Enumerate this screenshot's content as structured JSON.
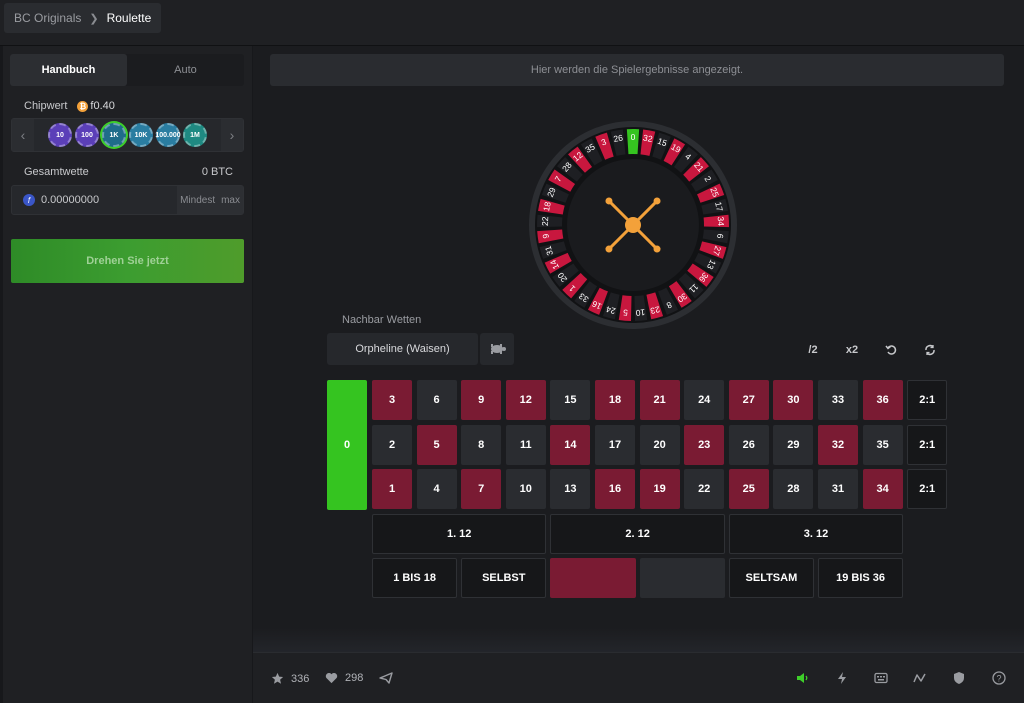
{
  "breadcrumb": {
    "parent": "BC Originals",
    "current": "Roulette"
  },
  "left_panel": {
    "tabs": [
      {
        "label": "Handbuch",
        "active": true
      },
      {
        "label": "Auto",
        "active": false
      }
    ],
    "chip_value_label": "Chipwert",
    "chip_value": "0.40",
    "chip_value_prefix": "f",
    "chips": [
      {
        "label": "10",
        "color": "#5b3fb8",
        "selected": false
      },
      {
        "label": "100",
        "color": "#5b3fb8",
        "selected": false
      },
      {
        "label": "1K",
        "color": "#1f6c8a",
        "selected": true
      },
      {
        "label": "10K",
        "color": "#2a7da1",
        "selected": false
      },
      {
        "label": "100.000",
        "color": "#2a7da1",
        "selected": false
      },
      {
        "label": "1M",
        "color": "#1f8a82",
        "selected": false
      }
    ],
    "total_bet_label": "Gesamtwette",
    "total_bet_value": "0 BTC",
    "bet_input_value": "0.00000000",
    "bet_min_label": "Mindest",
    "bet_max_label": "max",
    "spin_label": "Drehen Sie jetzt"
  },
  "results_text": "Hier werden die Spielergebnisse angezeigt.",
  "wheel": {
    "numbers": [
      0,
      32,
      15,
      19,
      4,
      21,
      2,
      25,
      17,
      34,
      6,
      27,
      13,
      36,
      11,
      30,
      8,
      23,
      10,
      5,
      24,
      16,
      33,
      1,
      20,
      14,
      31,
      9,
      22,
      18,
      29,
      7,
      28,
      12,
      35,
      3,
      26
    ],
    "red_color": "#c8173e",
    "black_color": "#1e1f23",
    "green_color": "#35c420"
  },
  "neighbour": {
    "label": "Nachbar Wetten",
    "selected": "Orpheline (Waisen)"
  },
  "tools": {
    "half": "/2",
    "double": "x2"
  },
  "board": {
    "zero": "0",
    "rows": [
      [
        3,
        6,
        9,
        12,
        15,
        18,
        21,
        24,
        27,
        30,
        33,
        36
      ],
      [
        2,
        5,
        8,
        11,
        14,
        17,
        20,
        23,
        26,
        29,
        32,
        35
      ],
      [
        1,
        4,
        7,
        10,
        13,
        16,
        19,
        22,
        25,
        28,
        31,
        34
      ]
    ],
    "reds": [
      1,
      3,
      5,
      7,
      9,
      12,
      14,
      16,
      18,
      19,
      21,
      23,
      25,
      27,
      30,
      32,
      34,
      36
    ],
    "column_label": "2:1",
    "dozens": [
      "1. 12",
      "2. 12",
      "3. 12"
    ],
    "outside": [
      "1 BIS 18",
      "SELBST",
      "",
      "",
      "SELTSAM",
      "19 BIS 36"
    ]
  },
  "footer": {
    "favorites": "336",
    "likes": "298"
  }
}
